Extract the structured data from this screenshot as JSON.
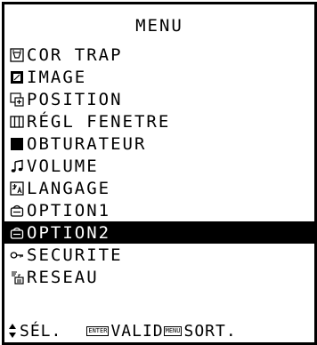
{
  "menu": {
    "title": "MENU",
    "items": [
      {
        "label": "COR TRAP",
        "icon": "keystone-icon"
      },
      {
        "label": "IMAGE",
        "icon": "image-icon"
      },
      {
        "label": "POSITION",
        "icon": "position-icon"
      },
      {
        "label": "RÉGL FENETRE",
        "icon": "window-adjust-icon"
      },
      {
        "label": "OBTURATEUR",
        "icon": "shutter-icon"
      },
      {
        "label": "VOLUME",
        "icon": "music-note-icon"
      },
      {
        "label": "LANGAGE",
        "icon": "language-icon"
      },
      {
        "label": "OPTION1",
        "icon": "option-icon"
      },
      {
        "label": "OPTION2",
        "icon": "option-icon",
        "selected": true
      },
      {
        "label": "SECURITE",
        "icon": "key-icon"
      },
      {
        "label": "RESEAU",
        "icon": "network-icon"
      }
    ]
  },
  "footer": {
    "select_label": "SÉL.",
    "enter_key": "ENTER",
    "enter_label": "VALID",
    "menu_key": "MENU",
    "menu_label": "SORT."
  },
  "colors": {
    "background": "#ffffff",
    "foreground": "#000000",
    "selected_bg": "#000000",
    "selected_fg": "#ffffff"
  }
}
